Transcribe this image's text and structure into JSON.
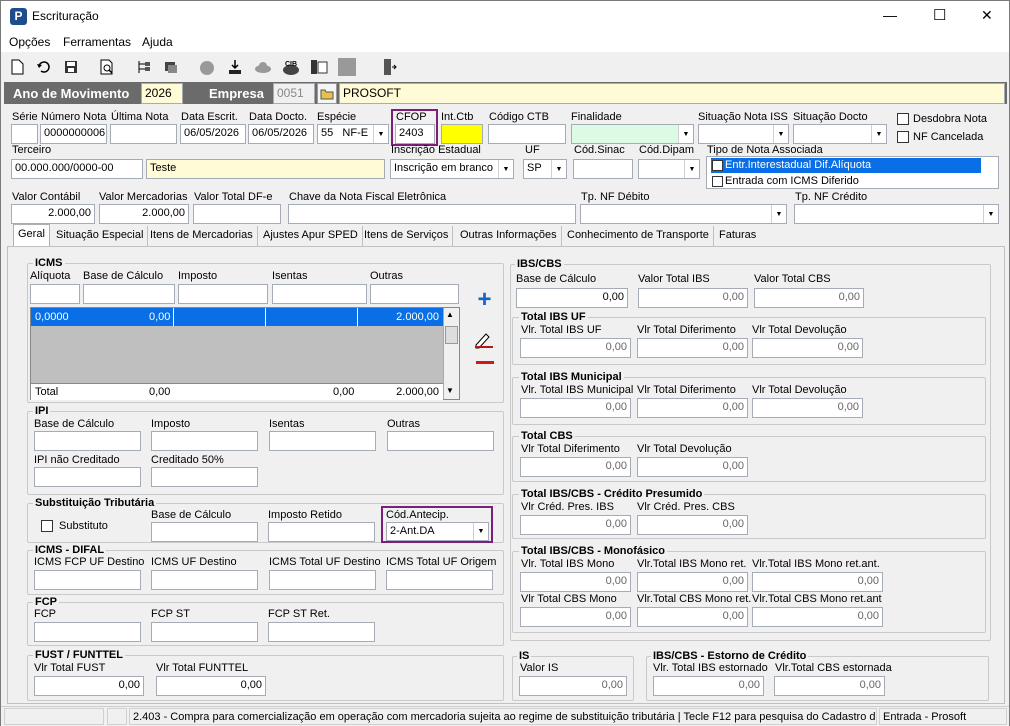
{
  "window": {
    "title": "Escrituração",
    "min": "—",
    "max": "☐",
    "close": "✕"
  },
  "menu": [
    "Opções",
    "Ferramentas",
    "Ajuda"
  ],
  "header": {
    "ano_label": "Ano de Movimento",
    "ano_value": "2026",
    "empresa_label": "Empresa",
    "empresa_code": "0051",
    "empresa_name": "PROSOFT"
  },
  "form": {
    "serie_label": "Série",
    "serie": "",
    "numero_label": "Número Nota",
    "numero": "0000000006",
    "ultima_label": "Última Nota",
    "ultima": "",
    "data_escrit_label": "Data Escrit.",
    "data_escrit": "06/05/2026",
    "data_docto_label": "Data Docto.",
    "data_docto": "06/05/2026",
    "especie_label": "Espécie",
    "especie_code": "55",
    "especie_value": "NF-E",
    "cfop_label": "CFOP",
    "cfop": "2403",
    "intctb_label": "Int.Ctb",
    "intctb": "",
    "codigo_ctb_label": "Código CTB",
    "codigo_ctb": "",
    "finalidade_label": "Finalidade",
    "finalidade": "",
    "sit_iss_label": "Situação Nota ISS",
    "sit_iss": "",
    "sit_docto_label": "Situação Docto",
    "sit_docto": "",
    "desdobra_label": "Desdobra Nota",
    "nf_cancelada_label": "NF Cancelada",
    "terceiro_label": "Terceiro",
    "terceiro_doc": "00.000.000/0000-00",
    "terceiro_nome": "Teste",
    "inscricao_label": "Inscrição Estadual",
    "inscricao": "Inscrição em branco",
    "uf_label": "UF",
    "uf": "SP",
    "cod_sinac_label": "Cód.Sinac",
    "cod_sinac": "",
    "cod_dipam_label": "Cód.Dipam",
    "cod_dipam": "",
    "tipo_nota_label": "Tipo de Nota Associada",
    "tipo_nota_items": [
      "Entr.Interestadual Dif.Alíquota",
      "Entrada com ICMS Diferido"
    ],
    "valor_contabil_label": "Valor Contábil",
    "valor_contabil": "2.000,00",
    "valor_merc_label": "Valor Mercadorias",
    "valor_merc": "2.000,00",
    "valor_dfe_label": "Valor Total DF-e",
    "valor_dfe": "",
    "chave_label": "Chave da Nota Fiscal Eletrônica",
    "chave": "",
    "tp_debito_label": "Tp. NF Débito",
    "tp_debito": "",
    "tp_credito_label": "Tp. NF Crédito",
    "tp_credito": ""
  },
  "tabs": [
    "Geral",
    "Situação Especial",
    "Itens de Mercadorias",
    "Ajustes Apur SPED",
    "Itens de Serviços",
    "Outras Informações",
    "Conhecimento de Transporte",
    "Faturas"
  ],
  "icms": {
    "title": "ICMS",
    "aliquota": "Alíquota",
    "base": "Base de Cálculo",
    "imposto": "Imposto",
    "isentas": "Isentas",
    "outras": "Outras",
    "row": [
      "0,0000",
      "0,00",
      "",
      "",
      "2.000,00"
    ],
    "total_label": "Total",
    "total": [
      "0,00",
      "0,00",
      "2.000,00"
    ]
  },
  "ipi": {
    "title": "IPI",
    "base": "Base de Cálculo",
    "imposto": "Imposto",
    "isentas": "Isentas",
    "outras": "Outras",
    "nao_cred": "IPI não Creditado",
    "cred50": "Creditado 50%"
  },
  "st": {
    "title": "Substituição Tributária",
    "substituto": "Substituto",
    "base": "Base de Cálculo",
    "retido": "Imposto Retido",
    "cod_antecip": "Cód.Antecip.",
    "cod_antecip_value": "2-Ant.DA"
  },
  "difal": {
    "title": "ICMS - DIFAL",
    "fcp": "ICMS FCP UF Destino",
    "uf_dest": "ICMS UF Destino",
    "total_dest": "ICMS Total UF Destino",
    "total_orig": "ICMS Total UF Origem"
  },
  "fcp": {
    "title": "FCP",
    "fcp": "FCP",
    "fcp_st": "FCP ST",
    "fcp_st_ret": "FCP ST Ret."
  },
  "fust": {
    "title": "FUST / FUNTTEL",
    "vlr_fust": "Vlr Total FUST",
    "vlr_funttel": "Vlr Total FUNTTEL",
    "v1": "0,00",
    "v2": "0,00"
  },
  "ibs": {
    "title": "IBS/CBS",
    "base": "Base de Cálculo",
    "vt_ibs": "Valor Total IBS",
    "vt_cbs": "Valor Total CBS",
    "base_v": "0,00",
    "vt_ibs_v": "0,00",
    "vt_cbs_v": "0,00",
    "uf_title": "Total IBS UF",
    "uf1": "Vlr. Total IBS UF",
    "uf2": "Vlr Total Diferimento",
    "uf3": "Vlr Total Devolução",
    "mun_title": "Total IBS Municipal",
    "mun1": "Vlr. Total IBS Municipal",
    "mun2": "Vlr Total Diferimento",
    "mun3": "Vlr Total Devolução",
    "cbs_title": "Total CBS",
    "cbs1": "Vlr Total Diferimento",
    "cbs2": "Vlr Total Devolução",
    "cp_title": "Total IBS/CBS - Crédito Presumido",
    "cp1": "Vlr Créd. Pres. IBS",
    "cp2": "Vlr Créd. Pres. CBS",
    "mono_title": "Total IBS/CBS - Monofásico",
    "m1": "Vlr. Total IBS Mono",
    "m2": "Vlr.Total IBS Mono ret.",
    "m3": "Vlr.Total IBS Mono ret.ant.",
    "m4": "Vlr Total CBS Mono",
    "m5": "Vlr.Total CBS Mono ret.",
    "m6": "Vlr.Total CBS Mono ret.ant",
    "zero": "0,00"
  },
  "is": {
    "title": "IS",
    "valor": "Valor IS",
    "v": "0,00"
  },
  "estorno": {
    "title": "IBS/CBS - Estorno de Crédito",
    "e1": "Vlr. Total IBS estornado",
    "e2": "Vlr.Total CBS estornada",
    "v1": "0,00",
    "v2": "0,00"
  },
  "status": {
    "text": "2.403 - Compra para comercialização em operação com mercadoria sujeita ao regime de substituição tributária | Tecle F12 para pesquisa do Cadastro d",
    "right": "Entrada - Prosoft"
  }
}
